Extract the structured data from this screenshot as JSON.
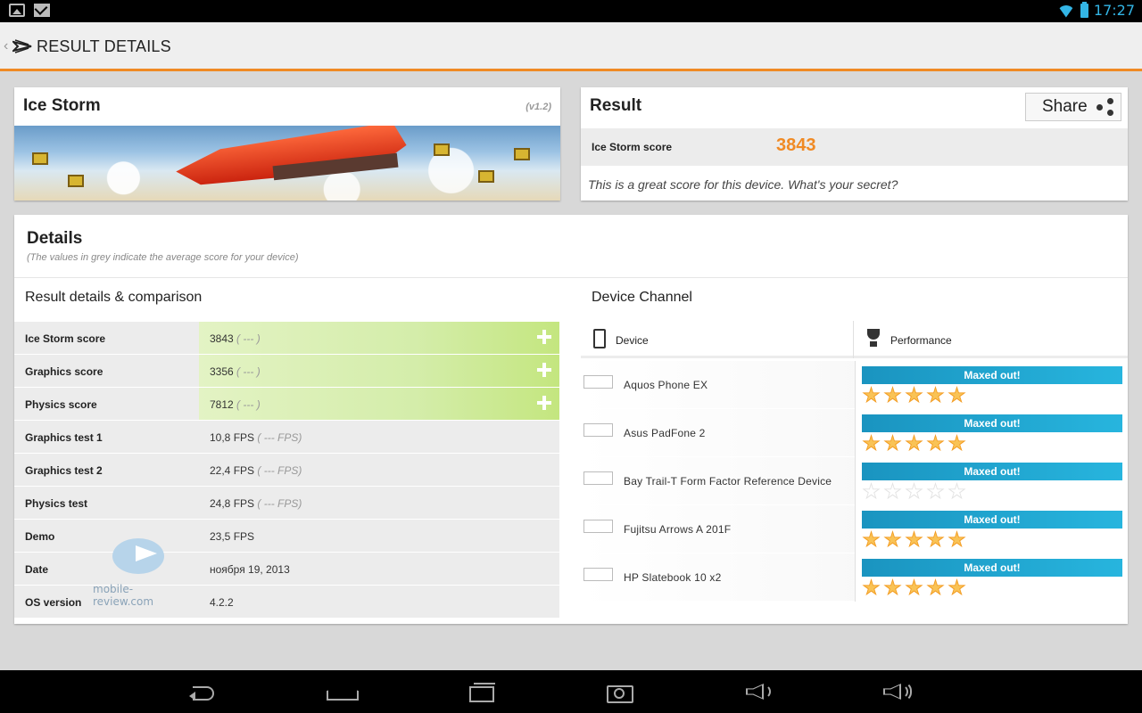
{
  "status_bar": {
    "time": "17:27",
    "icons": [
      "image-notification-icon",
      "gmail-notification-icon",
      "wifi-icon",
      "battery-icon"
    ]
  },
  "action_bar": {
    "title": "RESULT DETAILS",
    "accent_color": "#f08a24"
  },
  "test": {
    "name": "Ice Storm",
    "version": "(v1.2)"
  },
  "result": {
    "title": "Result",
    "share_label": "Share",
    "score_label": "Ice Storm score",
    "score_value": "3843",
    "message": "This is a great score for this device. What's your secret?"
  },
  "details": {
    "title": "Details",
    "subtitle": "(The values in grey indicate the average score for your device)",
    "comparison_title": "Result details & comparison",
    "rows": [
      {
        "label": "Ice Storm score",
        "value": "3843",
        "avg": "( --- )",
        "expandable": true
      },
      {
        "label": "Graphics score",
        "value": "3356",
        "avg": "( --- )",
        "expandable": true
      },
      {
        "label": "Physics score",
        "value": "7812",
        "avg": "( --- )",
        "expandable": true
      },
      {
        "label": "Graphics test 1",
        "value": "10,8 FPS",
        "avg": "( --- FPS)",
        "expandable": false
      },
      {
        "label": "Graphics test 2",
        "value": "22,4 FPS",
        "avg": "( --- FPS)",
        "expandable": false
      },
      {
        "label": "Physics test",
        "value": "24,8 FPS",
        "avg": "( --- FPS)",
        "expandable": false
      },
      {
        "label": "Demo",
        "value": "23,5 FPS",
        "avg": "",
        "expandable": false
      },
      {
        "label": "Date",
        "value": "ноября 19, 2013",
        "avg": "",
        "expandable": false
      },
      {
        "label": "OS version",
        "value": "4.2.2",
        "avg": "",
        "expandable": false
      }
    ]
  },
  "device_channel": {
    "title": "Device Channel",
    "col_device": "Device",
    "col_performance": "Performance",
    "devices": [
      {
        "name": "Aquos Phone EX",
        "status": "Maxed out!",
        "stars": 5
      },
      {
        "name": "Asus PadFone 2",
        "status": "Maxed out!",
        "stars": 5
      },
      {
        "name": "Bay Trail-T Form Factor Reference Device",
        "status": "Maxed out!",
        "stars": 0
      },
      {
        "name": "Fujitsu Arrows A 201F",
        "status": "Maxed out!",
        "stars": 5
      },
      {
        "name": "HP Slatebook 10 x2",
        "status": "Maxed out!",
        "stars": 5
      }
    ]
  },
  "watermark": "mobile-review.com",
  "colors": {
    "score_orange": "#f08a24",
    "maxed_blue": "#1a94c0",
    "star_orange": "#f39c22",
    "status_blue": "#33b5e5"
  }
}
